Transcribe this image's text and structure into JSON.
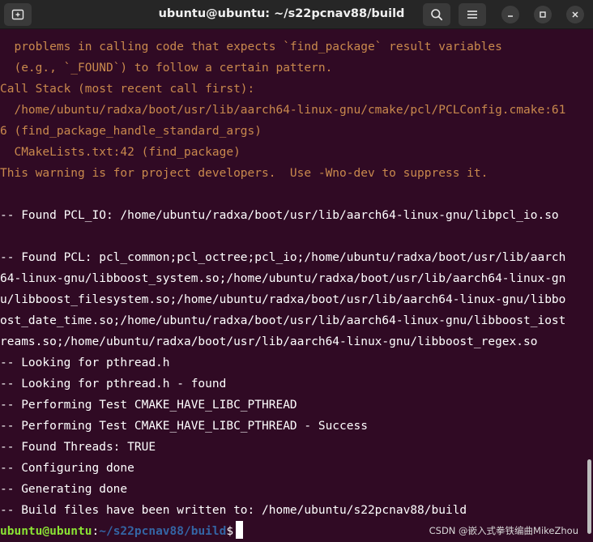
{
  "window": {
    "title": "ubuntu@ubuntu: ~/s22pcnav88/build"
  },
  "titlebar": {
    "new_tab_icon": "new-tab-icon",
    "search_icon": "search-icon",
    "menu_icon": "hamburger-menu-icon",
    "minimize_icon": "minimize-icon",
    "maximize_icon": "maximize-icon",
    "close_icon": "close-icon"
  },
  "colors": {
    "background": "#300a24",
    "warning_text": "#c9894d",
    "normal_text": "#ffffff",
    "prompt_user": "#8ae234",
    "prompt_path": "#3465a4"
  },
  "terminal": {
    "lines": [
      {
        "text": "  problems in calling code that expects `find_package` result variables",
        "style": "warn"
      },
      {
        "text": "  (e.g., `_FOUND`) to follow a certain pattern.",
        "style": "warn"
      },
      {
        "text": "Call Stack (most recent call first):",
        "style": "warn"
      },
      {
        "text": "  /home/ubuntu/radxa/boot/usr/lib/aarch64-linux-gnu/cmake/pcl/PCLConfig.cmake:61",
        "style": "warn"
      },
      {
        "text": "6 (find_package_handle_standard_args)",
        "style": "warn"
      },
      {
        "text": "  CMakeLists.txt:42 (find_package)",
        "style": "warn"
      },
      {
        "text": "This warning is for project developers.  Use -Wno-dev to suppress it.",
        "style": "warn"
      },
      {
        "text": "",
        "style": "normal"
      },
      {
        "text": "-- Found PCL_IO: /home/ubuntu/radxa/boot/usr/lib/aarch64-linux-gnu/libpcl_io.so",
        "style": "normal"
      },
      {
        "text": "",
        "style": "normal"
      },
      {
        "text": "-- Found PCL: pcl_common;pcl_octree;pcl_io;/home/ubuntu/radxa/boot/usr/lib/aarch",
        "style": "normal"
      },
      {
        "text": "64-linux-gnu/libboost_system.so;/home/ubuntu/radxa/boot/usr/lib/aarch64-linux-gn",
        "style": "normal"
      },
      {
        "text": "u/libboost_filesystem.so;/home/ubuntu/radxa/boot/usr/lib/aarch64-linux-gnu/libbo",
        "style": "normal"
      },
      {
        "text": "ost_date_time.so;/home/ubuntu/radxa/boot/usr/lib/aarch64-linux-gnu/libboost_iost",
        "style": "normal"
      },
      {
        "text": "reams.so;/home/ubuntu/radxa/boot/usr/lib/aarch64-linux-gnu/libboost_regex.so",
        "style": "normal"
      },
      {
        "text": "-- Looking for pthread.h",
        "style": "normal"
      },
      {
        "text": "-- Looking for pthread.h - found",
        "style": "normal"
      },
      {
        "text": "-- Performing Test CMAKE_HAVE_LIBC_PTHREAD",
        "style": "normal"
      },
      {
        "text": "-- Performing Test CMAKE_HAVE_LIBC_PTHREAD - Success",
        "style": "normal"
      },
      {
        "text": "-- Found Threads: TRUE",
        "style": "normal"
      },
      {
        "text": "-- Configuring done",
        "style": "normal"
      },
      {
        "text": "-- Generating done",
        "style": "normal"
      },
      {
        "text": "-- Build files have been written to: /home/ubuntu/s22pcnav88/build",
        "style": "normal"
      }
    ],
    "prompt": {
      "user_host": "ubuntu@ubuntu",
      "separator": ":",
      "path": "~/s22pcnav88/build",
      "symbol": "$"
    }
  },
  "watermark": "CSDN @嵌入式拳铁编曲MikeZhou"
}
